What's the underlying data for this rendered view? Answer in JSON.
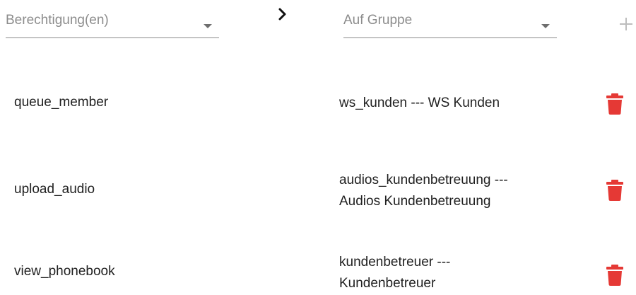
{
  "header": {
    "permission_placeholder": "Berechtigung(en)",
    "group_placeholder": "Auf Gruppe",
    "arrow_icon": "chevron-right-icon",
    "add_icon": "plus-icon"
  },
  "rows": [
    {
      "permission": "queue_member",
      "group_line1": "ws_kunden --- WS Kunden",
      "group_line2": "",
      "delete_icon": "trash-icon"
    },
    {
      "permission": "upload_audio",
      "group_line1": "audios_kundenbetreuung ---",
      "group_line2": "Audios Kundenbetreuung",
      "delete_icon": "trash-icon"
    },
    {
      "permission": "view_phonebook",
      "group_line1": "kundenbetreuer ---",
      "group_line2": "Kundenbetreuer",
      "delete_icon": "trash-icon"
    }
  ],
  "colors": {
    "delete": "#e53935",
    "placeholder": "#8c8c8c",
    "text": "#212121",
    "underline": "#8a8a8a"
  }
}
